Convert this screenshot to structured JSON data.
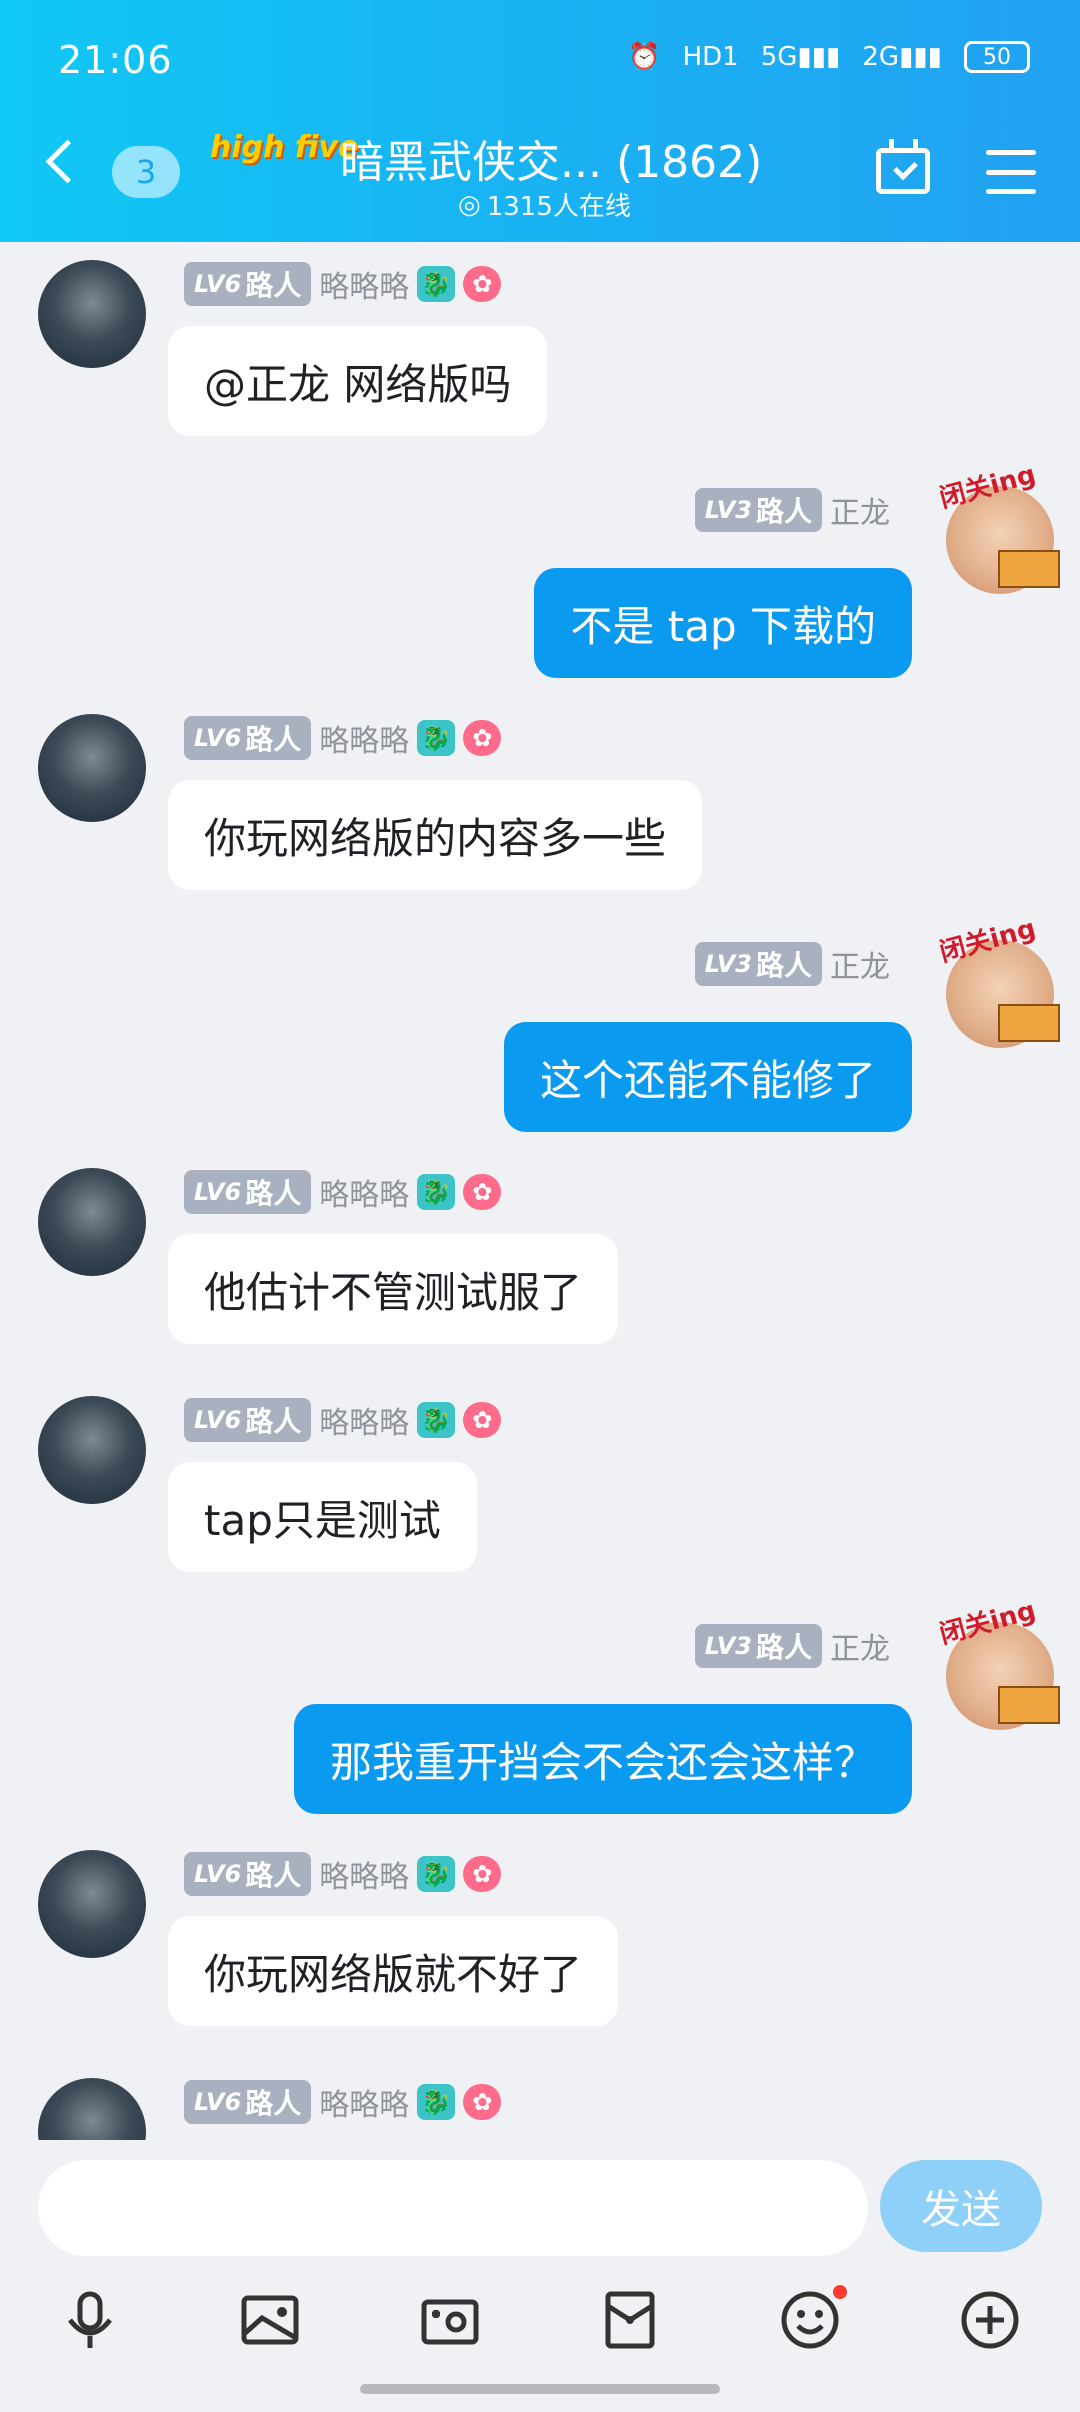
{
  "status_bar": {
    "time": "21:06",
    "hd": "HD1",
    "sig1": "5G",
    "sig2": "2G",
    "battery": "50"
  },
  "header": {
    "unread_count": "3",
    "logo_text": "high five",
    "group_name": "暗黑武侠交...",
    "member_count": "(1862)",
    "online_text": "1315人在线"
  },
  "messages": [
    {
      "side": "left",
      "level": "LV6",
      "role": "路人",
      "nick": "略略略",
      "text": "@正龙 网络版吗"
    },
    {
      "side": "right",
      "level": "LV3",
      "role": "路人",
      "nick": "正龙",
      "text": "不是   tap  下载的"
    },
    {
      "side": "left",
      "level": "LV6",
      "role": "路人",
      "nick": "略略略",
      "text": "你玩网络版的内容多一些"
    },
    {
      "side": "right",
      "level": "LV3",
      "role": "路人",
      "nick": "正龙",
      "text": "这个还能不能修了"
    },
    {
      "side": "left",
      "level": "LV6",
      "role": "路人",
      "nick": "略略略",
      "text": "他估计不管测试服了"
    },
    {
      "side": "left",
      "level": "LV6",
      "role": "路人",
      "nick": "略略略",
      "text": "tap只是测试"
    },
    {
      "side": "right",
      "level": "LV3",
      "role": "路人",
      "nick": "正龙",
      "text": "那我重开挡会不会还会这样？"
    },
    {
      "side": "left",
      "level": "LV6",
      "role": "路人",
      "nick": "略略略",
      "text": "你玩网络版就不好了"
    },
    {
      "side": "left",
      "level": "LV6",
      "role": "路人",
      "nick": "略略略",
      "text": ""
    }
  ],
  "sticker_tag": "闭关ing",
  "composer": {
    "placeholder": "",
    "send_label": "发送"
  },
  "toolbar": [
    "microphone-icon",
    "image-icon",
    "camera-icon",
    "red-packet-icon",
    "emoji-icon",
    "plus-icon"
  ]
}
